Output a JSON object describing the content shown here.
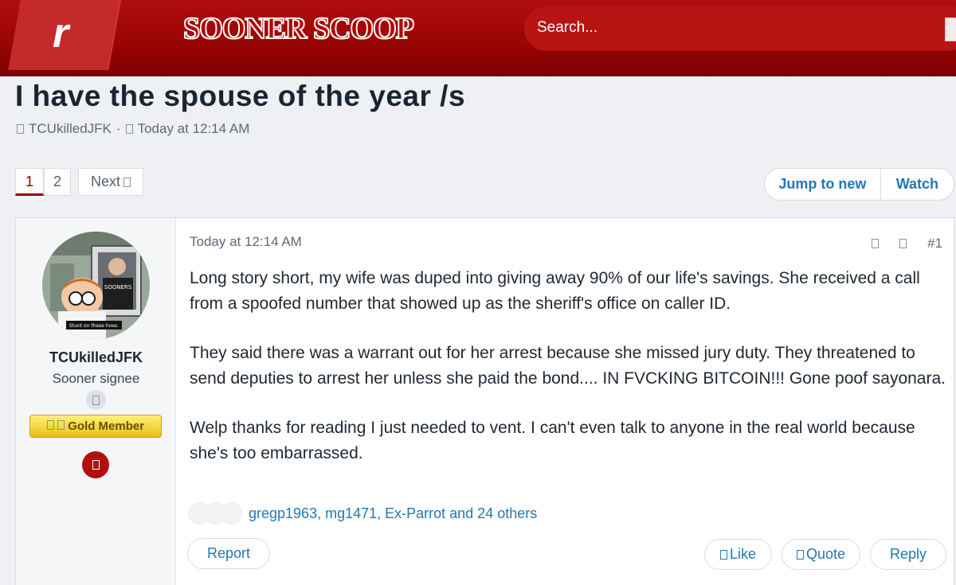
{
  "header": {
    "logo_letter": "r",
    "brand": "SOONER SCOOP",
    "search_placeholder": "Search..."
  },
  "thread": {
    "title": "I have the spouse of the year /s",
    "author": "TCUkilledJFK",
    "separator": "·",
    "time": "Today at 12:14 AM"
  },
  "pagination": {
    "page1": "1",
    "page2": "2",
    "next": "Next"
  },
  "actions": {
    "jump": "Jump to new",
    "watch": "Watch"
  },
  "post": {
    "username": "TCUkilledJFK",
    "user_title": "Sooner signee",
    "membership": "Gold Member",
    "avatar_caption": "Stunt on these hoes.",
    "avatar_shirt": "SOONERS",
    "time": "Today at 12:14 AM",
    "number": "#1",
    "paragraphs": [
      "Long story short, my wife was duped into giving away 90% of our life's savings. She received a call from a spoofed number that showed up as the sheriff's office on caller ID.",
      "They said there was a warrant out for her arrest because she missed jury duty. They threatened to send deputies to arrest her unless she paid the bond.... IN FVCKING BITCOIN!!! Gone poof sayonara.",
      "Welp thanks for reading I just needed to vent. I can't even talk to anyone in the real world because she's too embarrassed."
    ],
    "reactions": "gregp1963, mg1471, Ex-Parrot and 24 others",
    "report": "Report",
    "like": "Like",
    "quote": "Quote",
    "reply": "Reply"
  },
  "colors": {
    "header_red": "#9a0505",
    "link_blue": "#2577b1",
    "gold": "#f3d53a"
  }
}
